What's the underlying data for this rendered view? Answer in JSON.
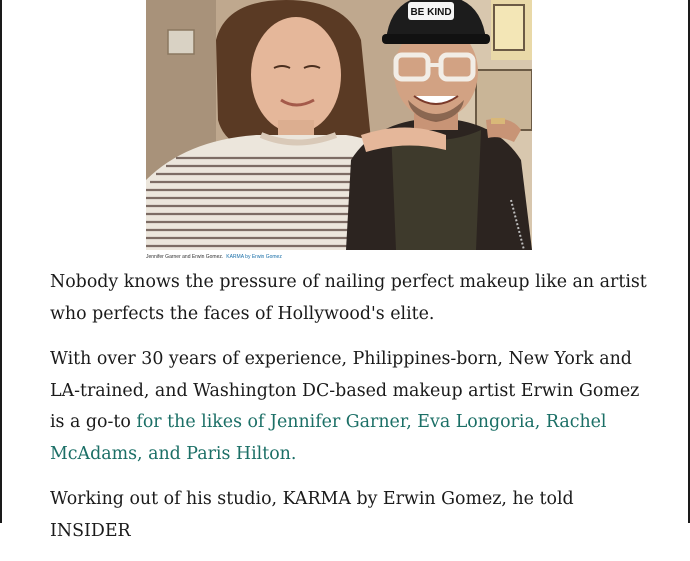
{
  "image": {
    "caption": "Jennifer Garner and Erwin Gomez.",
    "credit": "KARMA by Erwin Gomez",
    "hat_text": "BE KIND"
  },
  "article": {
    "p1": "Nobody knows the pressure of nailing perfect makeup like an artist who perfects the faces of Hollywood's elite.",
    "p2_before": "With over 30 years of experience, Philippines-born, New York and LA-trained, and Washington DC-based makeup artist Erwin Gomez is a go-to ",
    "p2_link": "for the likes of Jennifer Garner, Eva Longoria, Rachel McAdams, and Paris Hilton.",
    "p3": "Working out of his studio, KARMA by Erwin Gomez, he told INSIDER"
  },
  "colors": {
    "link": "#1b6f66",
    "text": "#1a1a1a",
    "credit": "#1a6fa8"
  }
}
